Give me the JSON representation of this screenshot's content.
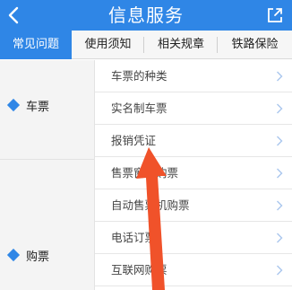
{
  "header": {
    "title": "信息服务"
  },
  "tabs": [
    {
      "label": "常见问题",
      "active": true
    },
    {
      "label": "使用须知",
      "active": false
    },
    {
      "label": "相关规章",
      "active": false
    },
    {
      "label": "铁路保险",
      "active": false
    }
  ],
  "categories": [
    {
      "label": "车票"
    },
    {
      "label": "购票"
    }
  ],
  "list": [
    {
      "label": "车票的种类"
    },
    {
      "label": "实名制车票"
    },
    {
      "label": "报销凭证"
    },
    {
      "label": "售票窗口购票"
    },
    {
      "label": "自动售票机购票"
    },
    {
      "label": "电话订票"
    },
    {
      "label": "互联网购票"
    }
  ],
  "colors": {
    "accent": "#2f86e6",
    "annotation_arrow": "#f0522a"
  }
}
